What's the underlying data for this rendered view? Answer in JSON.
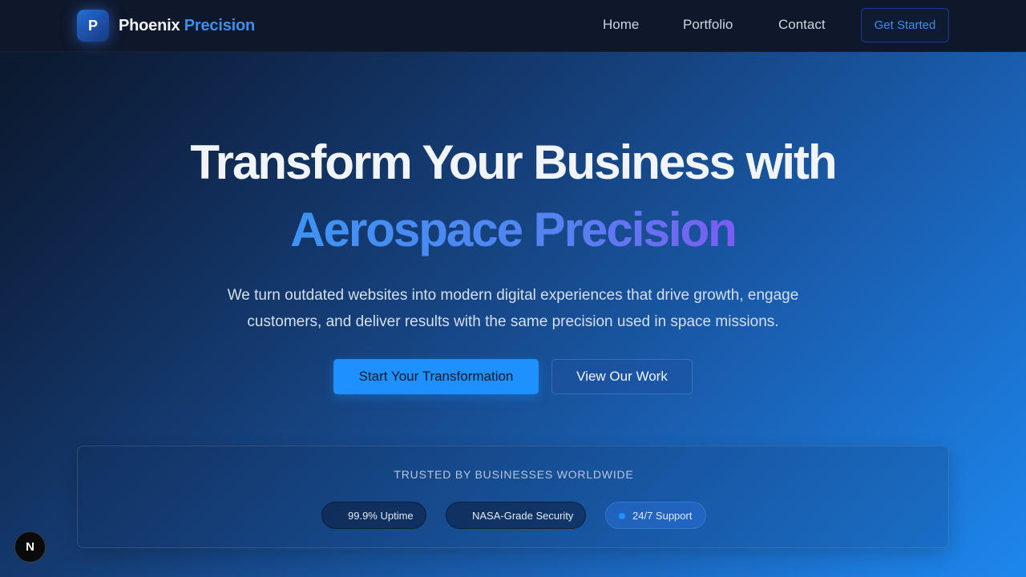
{
  "brand": {
    "logo_letter": "P",
    "name": "Phoenix",
    "accent": "Precision"
  },
  "nav": {
    "items": [
      {
        "label": "Home"
      },
      {
        "label": "Portfolio"
      },
      {
        "label": "Contact"
      }
    ],
    "cta_label": "Get Started"
  },
  "hero": {
    "title_line1": "Transform Your Business with",
    "title_line2": "Aerospace Precision",
    "subtitle": "We turn outdated websites into modern digital experiences that drive growth, engage customers, and deliver results with the same precision used in space missions.",
    "primary_button": "Start Your Transformation",
    "secondary_button": "View Our Work"
  },
  "trust": {
    "heading": "TRUSTED BY BUSINESSES WORLDWIDE",
    "badges": [
      {
        "label": "99.9% Uptime"
      },
      {
        "label": "NASA-Grade Security"
      },
      {
        "label": "24/7 Support",
        "dot_icon": "status-dot-icon"
      }
    ]
  },
  "dev_indicator": {
    "letter": "N",
    "icon": "framework-logo-icon"
  },
  "colors": {
    "accent": "#1e90ff",
    "nav_background": "#0f172a",
    "gradient_start": "#0b1628",
    "gradient_end": "#1d87ee",
    "heading_gradient_end": "#7c5cf0"
  }
}
